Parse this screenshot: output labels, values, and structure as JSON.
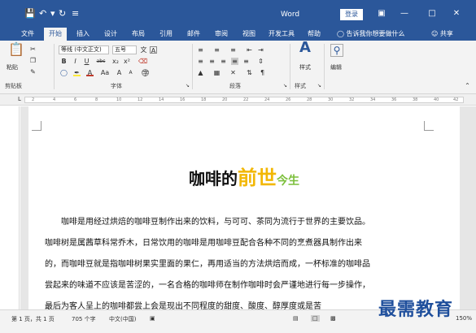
{
  "window": {
    "title": "Word",
    "login_label": "登录",
    "icons": [
      "save-icon",
      "undo-icon",
      "redo-icon",
      "customize-icon"
    ],
    "controls": [
      "ribbon-display-icon",
      "minimize-icon",
      "maximize-icon",
      "close-icon"
    ]
  },
  "tabs": [
    "文件",
    "开始",
    "插入",
    "设计",
    "布局",
    "引用",
    "邮件",
    "审阅",
    "视图",
    "开发工具",
    "帮助"
  ],
  "active_tab": "开始",
  "tell_me": "告诉我你想要做什么",
  "share": "共享",
  "ribbon": {
    "clipboard": {
      "paste": "粘贴",
      "label": "剪贴板"
    },
    "font": {
      "name": "等线 (中文正文)",
      "size": "五号",
      "bold": "B",
      "italic": "I",
      "underline": "U",
      "strike": "abc",
      "subscript": "x₂",
      "superscript": "x²",
      "font_color": "A",
      "change_case": "Aa",
      "grow": "A",
      "shrink": "A",
      "enclose": "字",
      "wen": "文",
      "label": "字体"
    },
    "paragraph": {
      "label": "段落"
    },
    "styles": {
      "button": "样式",
      "label": "样式"
    },
    "editing": {
      "button": "编辑"
    }
  },
  "ruler": {
    "left": "L",
    "ticks": [
      "2",
      "4",
      "6",
      "8",
      "10",
      "12",
      "14",
      "16",
      "18",
      "20",
      "22",
      "24",
      "26",
      "28",
      "30",
      "32",
      "34",
      "36",
      "38",
      "40",
      "42"
    ]
  },
  "document": {
    "title_part1": "咖啡的",
    "title_part2": "前世",
    "title_part3": "今生",
    "lines": [
      "咖啡是用经过烘焙的咖啡豆制作出来的饮料，与可可、茶同为流行于世界的主要饮品。",
      "咖啡树是属茜草科常乔木，日常饮用的咖啡是用咖啡豆配合各种不同的烹煮器具制作出来",
      "的，而咖啡豆就是指咖啡树果实里面的果仁，再用适当的方法烘焙而成，一杯标准的咖啡品",
      "尝起来的味道不应该是苦涩的，一名合格的咖啡师在制作咖啡时会严谨地进行每一步操作，",
      "最后为客人呈上的咖啡都尝上会是现出不同程度的甜度、酸度、醇厚度或是苦"
    ]
  },
  "status": {
    "page": "第 1 页，共 1 页",
    "words": "705 个字",
    "language": "中文(中国)",
    "zoom": "150%"
  },
  "watermark": "最需教育"
}
